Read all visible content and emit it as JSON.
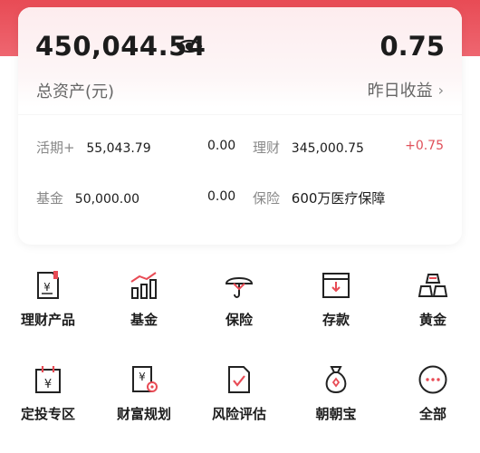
{
  "summary": {
    "total_amount": "450,044.54",
    "total_label": "总资产(元)",
    "yesterday_amount": "0.75",
    "yesterday_label": "昨日收益"
  },
  "breakdown": [
    {
      "label": "活期+",
      "value": "55,043.79",
      "change": "0.00"
    },
    {
      "label": "理财",
      "value": "345,000.75",
      "change": "+0.75"
    },
    {
      "label": "基金",
      "value": "50,000.00",
      "change": "0.00"
    },
    {
      "label": "保险",
      "value": "600万医疗保障"
    }
  ],
  "grid": {
    "items": [
      {
        "label": "理财产品",
        "icon": "wealth-product-icon"
      },
      {
        "label": "基金",
        "icon": "fund-chart-icon"
      },
      {
        "label": "保险",
        "icon": "umbrella-icon"
      },
      {
        "label": "存款",
        "icon": "deposit-icon"
      },
      {
        "label": "黄金",
        "icon": "gold-bars-icon"
      },
      {
        "label": "定投专区",
        "icon": "calendar-yen-icon"
      },
      {
        "label": "财富规划",
        "icon": "wealth-plan-icon"
      },
      {
        "label": "风险评估",
        "icon": "risk-check-icon"
      },
      {
        "label": "朝朝宝",
        "icon": "money-bag-icon"
      },
      {
        "label": "全部",
        "icon": "more-icon"
      }
    ]
  },
  "colors": {
    "brand_red": "#e84b55",
    "positive": "#e0505a"
  }
}
